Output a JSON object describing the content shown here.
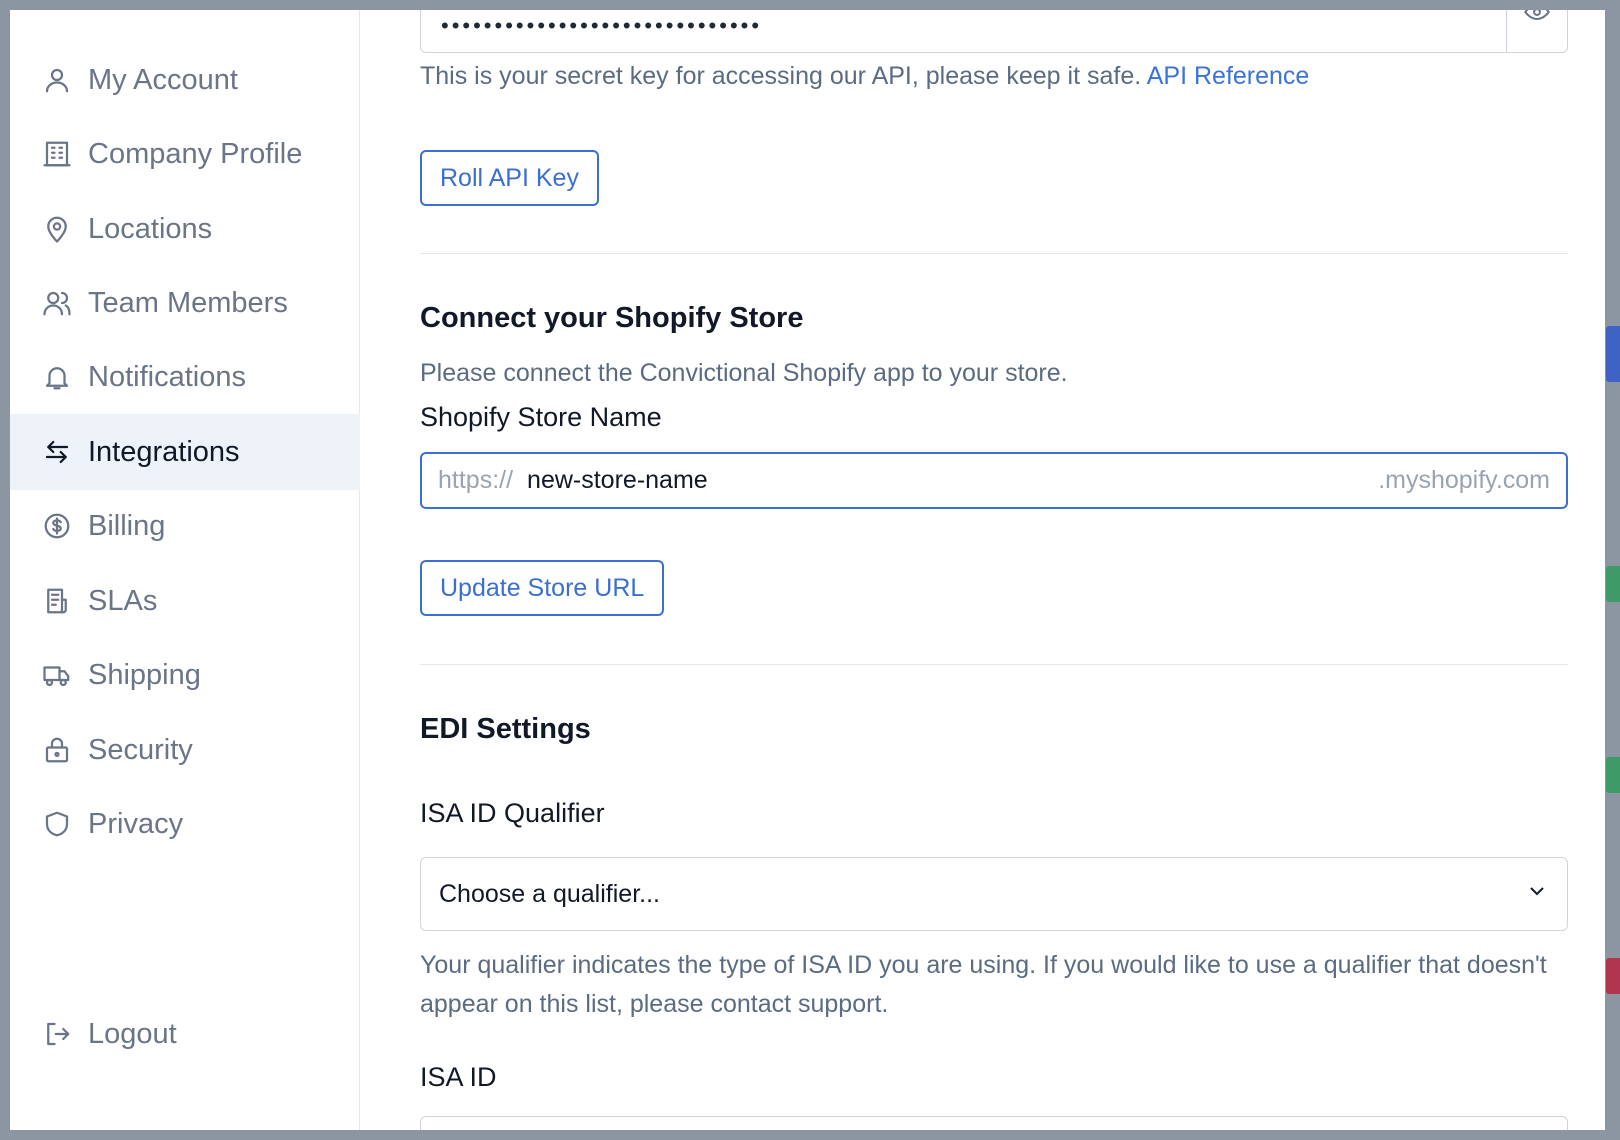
{
  "sidebar": {
    "items": [
      {
        "label": "My Account",
        "icon": "user-icon"
      },
      {
        "label": "Company Profile",
        "icon": "building-icon"
      },
      {
        "label": "Locations",
        "icon": "map-pin-icon"
      },
      {
        "label": "Team Members",
        "icon": "users-icon"
      },
      {
        "label": "Notifications",
        "icon": "bell-icon"
      },
      {
        "label": "Integrations",
        "icon": "arrows-swap-icon",
        "active": true
      },
      {
        "label": "Billing",
        "icon": "dollar-circle-icon"
      },
      {
        "label": "SLAs",
        "icon": "document-icon"
      },
      {
        "label": "Shipping",
        "icon": "truck-icon"
      },
      {
        "label": "Security",
        "icon": "lock-icon"
      },
      {
        "label": "Privacy",
        "icon": "shield-icon"
      }
    ],
    "logout": {
      "label": "Logout",
      "icon": "logout-icon"
    }
  },
  "api": {
    "key_masked": "••••••••••••••••••••••••••••••",
    "help": "This is your secret key for accessing our API, please keep it safe.",
    "reference_link": "API Reference",
    "roll_button": "Roll API Key"
  },
  "shopify": {
    "title": "Connect your Shopify Store",
    "description": "Please connect the Convictional Shopify app to your store.",
    "store_label": "Shopify Store Name",
    "url_prefix": "https://",
    "store_value": "new-store-name",
    "url_suffix": ".myshopify.com",
    "update_button": "Update Store URL"
  },
  "edi": {
    "title": "EDI Settings",
    "qualifier_label": "ISA ID Qualifier",
    "qualifier_selected": "Choose a qualifier...",
    "qualifier_help": "Your qualifier indicates the type of ISA ID you are using. If you would like to use a qualifier that doesn't appear on this list, please contact support.",
    "isa_id_label": "ISA ID"
  },
  "colors": {
    "accent": "#3b6fd0",
    "active_bg": "#eef2f9",
    "overlay": "#8c96a3"
  }
}
